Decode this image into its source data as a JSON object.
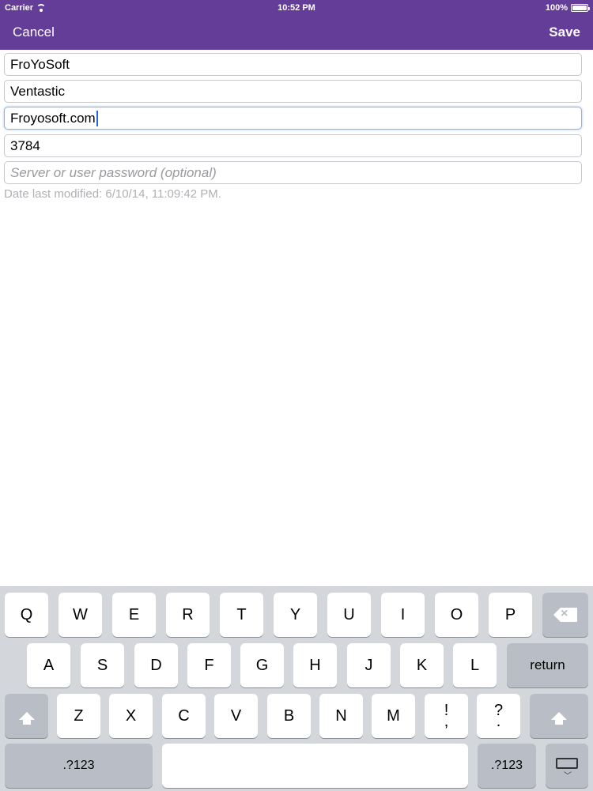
{
  "status_bar": {
    "carrier": "Carrier",
    "time": "10:52 PM",
    "battery": "100%"
  },
  "nav": {
    "cancel": "Cancel",
    "save": "Save"
  },
  "fields": {
    "name": {
      "value": "FroYoSoft"
    },
    "company": {
      "value": "Ventastic"
    },
    "server": {
      "value": "Froyosoft.com"
    },
    "port": {
      "value": "3784"
    },
    "password": {
      "placeholder": "Server or user password (optional)"
    }
  },
  "meta": {
    "date_modified": "Date last modified: 6/10/14, 11:09:42 PM."
  },
  "keyboard": {
    "row1": [
      "Q",
      "W",
      "E",
      "R",
      "T",
      "Y",
      "U",
      "I",
      "O",
      "P"
    ],
    "row2": [
      "A",
      "S",
      "D",
      "F",
      "G",
      "H",
      "J",
      "K",
      "L"
    ],
    "row3": [
      "Z",
      "X",
      "C",
      "V",
      "B",
      "N",
      "M"
    ],
    "punct1": {
      "top": "!",
      "bottom": ","
    },
    "punct2": {
      "top": "?",
      "bottom": "."
    },
    "return": "return",
    "numbers": ".?123",
    "icons": {
      "delete": "delete-icon",
      "shift": "shift-icon",
      "hide": "hide-keyboard-icon",
      "wifi": "wifi-icon",
      "battery": "battery-icon"
    }
  },
  "colors": {
    "header": "#633d98",
    "keyboard_bg": "#d3d6db",
    "dark_key": "#b9bec6",
    "focus_border": "#8db3e8"
  }
}
